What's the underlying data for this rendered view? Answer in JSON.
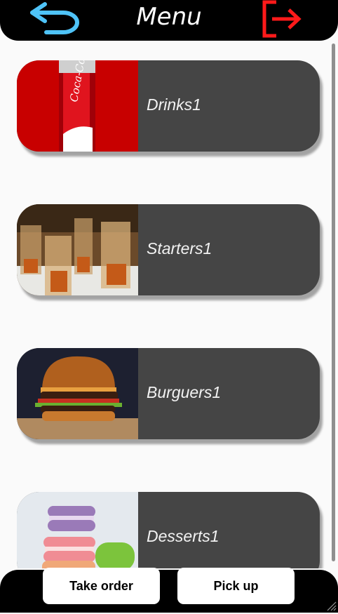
{
  "header": {
    "title": "Menu",
    "back_icon": "back-arrow-icon",
    "logout_icon": "logout-icon",
    "back_color": "#4fc3f7",
    "logout_color": "#ff1a1a"
  },
  "categories": [
    {
      "label": "Drinks1",
      "image": "cola-can-image"
    },
    {
      "label": "Starters1",
      "image": "shrimp-glasses-image"
    },
    {
      "label": "Burguers1",
      "image": "burger-image"
    },
    {
      "label": "Desserts1",
      "image": "macarons-image"
    }
  ],
  "footer": {
    "take_order_label": "Take order",
    "pick_up_label": "Pick up"
  },
  "colors": {
    "card_bg": "#454545",
    "bar_bg": "#000000",
    "page_bg": "#fafafa"
  }
}
